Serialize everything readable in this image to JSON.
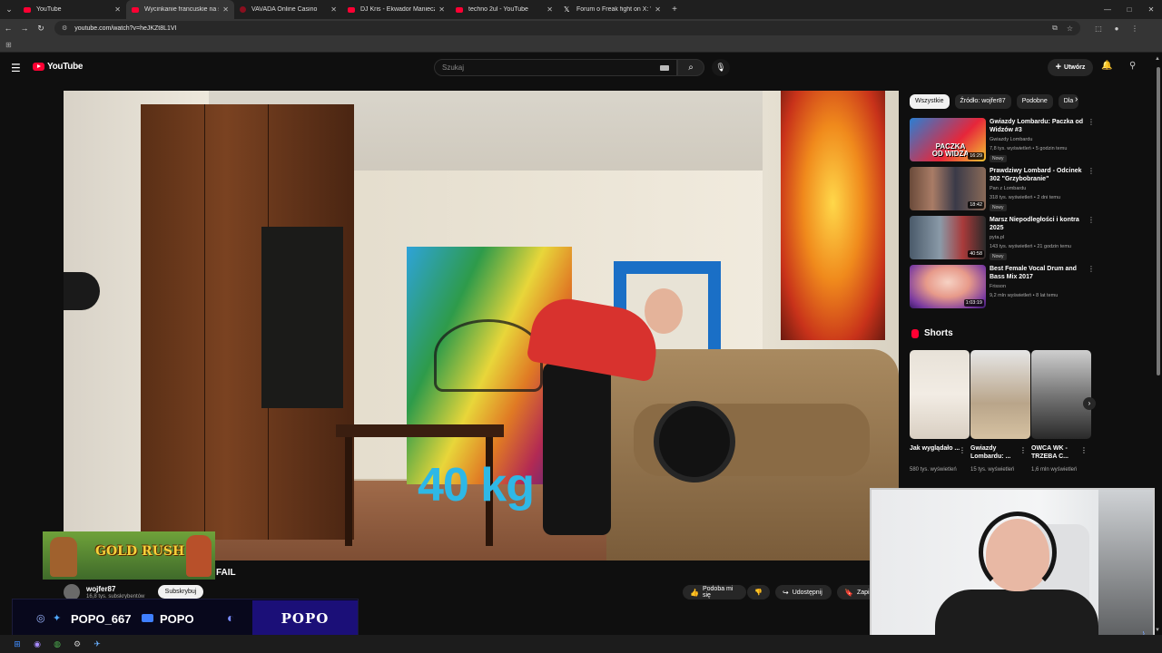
{
  "browser": {
    "tabs": [
      {
        "title": "YouTube",
        "active": false,
        "favicon": "youtube-icon"
      },
      {
        "title": "Wycinkanie francuskie na stole",
        "active": true,
        "favicon": "youtube-icon"
      },
      {
        "title": "VAVADA Online Casino",
        "active": false,
        "favicon": "vavada-icon"
      },
      {
        "title": "DJ Kris - Ekwador Manieczki | It",
        "active": false,
        "favicon": "youtube-icon"
      },
      {
        "title": "techno 2ul - YouTube",
        "active": false,
        "favicon": "youtube-icon"
      },
      {
        "title": "Forum o Freak fight on X: \"Artu",
        "active": false,
        "favicon": "x-icon"
      }
    ],
    "url": "youtube.com/watch?v=heJKZt8L1VI"
  },
  "masthead": {
    "logo_text": "YouTube",
    "search_placeholder": "Szukaj",
    "create_label": "Utwórz"
  },
  "video": {
    "overlay_text": "40 kg",
    "game_banner": "GOLD RUSH",
    "fail_label": "FAIL",
    "channel_name": "wojfer87",
    "subscribers": "16,8 tys. subskrybentów",
    "subscribe_label": "Subskrybuj",
    "like_label": "Podoba mi się",
    "share_label": "Udostępnij",
    "save_label": "Zapisz"
  },
  "stream_overlay": {
    "handle1": "POPO_667",
    "handle2": "POPO",
    "box_label": "POPO"
  },
  "sidebar": {
    "chips": [
      "Wszystkie",
      "Źródło: wojfer87",
      "Podobne",
      "Dla"
    ],
    "recommendations": [
      {
        "title": "Gwiazdy Lombardu: Paczka od Widzów #3",
        "channel": "Gwiazdy Lombardu",
        "meta": "7,8 tys. wyświetleń • 5 godzin temu",
        "badge": "Nowy",
        "duration": "16:29",
        "thumb_text": "PACZKA OD WIDZA"
      },
      {
        "title": "Prawdziwy Lombard - Odcinek 302 \"Grzybobranie\"",
        "channel": "Pan z Lombardu",
        "meta": "318 tys. wyświetleń • 2 dni temu",
        "badge": "Nowy",
        "duration": "18:42",
        "thumb_text": ""
      },
      {
        "title": "Marsz Niepodległości i kontra 2025",
        "channel": "pyta.pl",
        "meta": "143 tys. wyświetleń • 21 godzin temu",
        "badge": "Nowy",
        "duration": "40:58",
        "thumb_text": ""
      },
      {
        "title": "Best Female Vocal Drum and Bass Mix 2017",
        "channel": "Frisson",
        "meta": "9,2 mln wyświetleń • 8 lat temu",
        "badge": "",
        "duration": "1:03:19",
        "thumb_text": ""
      }
    ],
    "shorts_heading": "Shorts",
    "shorts": [
      {
        "title": "Jak wyglądało ...",
        "views": "580 tys. wyświetleń"
      },
      {
        "title": "Gwiazdy Lombardu: ...",
        "views": "15 tys. wyświetleń"
      },
      {
        "title": "OWCA WK - TRZEBA C...",
        "views": "1,6 mln wyświetleń"
      }
    ]
  },
  "colors": {
    "accent_red": "#ff0033",
    "kg_text": "#2eb8e6",
    "stream_box": "#1b0f78"
  }
}
